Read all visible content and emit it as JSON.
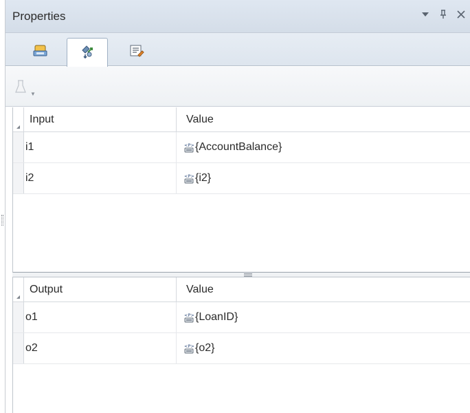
{
  "panel": {
    "title": "Properties",
    "controls": {
      "dropdown": "▾",
      "pin": "ᵖ",
      "close": "✕"
    }
  },
  "tabs": [
    {
      "name": "general-tab",
      "icon": "properties-icon",
      "active": false
    },
    {
      "name": "io-mapping-tab",
      "icon": "io-mapping-icon",
      "active": true
    },
    {
      "name": "notes-tab",
      "icon": "notes-icon",
      "active": false
    }
  ],
  "toolbar": {
    "icon": "flask-icon",
    "enabled": false
  },
  "input_grid": {
    "headers": [
      "Input",
      "Value"
    ],
    "rows": [
      {
        "name": "i1",
        "value": "{AccountBalance}"
      },
      {
        "name": "i2",
        "value": "{i2}"
      }
    ]
  },
  "output_grid": {
    "headers": [
      "Output",
      "Value"
    ],
    "rows": [
      {
        "name": "o1",
        "value": "{LoanID}"
      },
      {
        "name": "o2",
        "value": "{o2}"
      }
    ]
  },
  "colors": {
    "titlebar": "#d9e1ec",
    "tabrow": "#e3e9f0",
    "border": "#bfc5cc"
  }
}
